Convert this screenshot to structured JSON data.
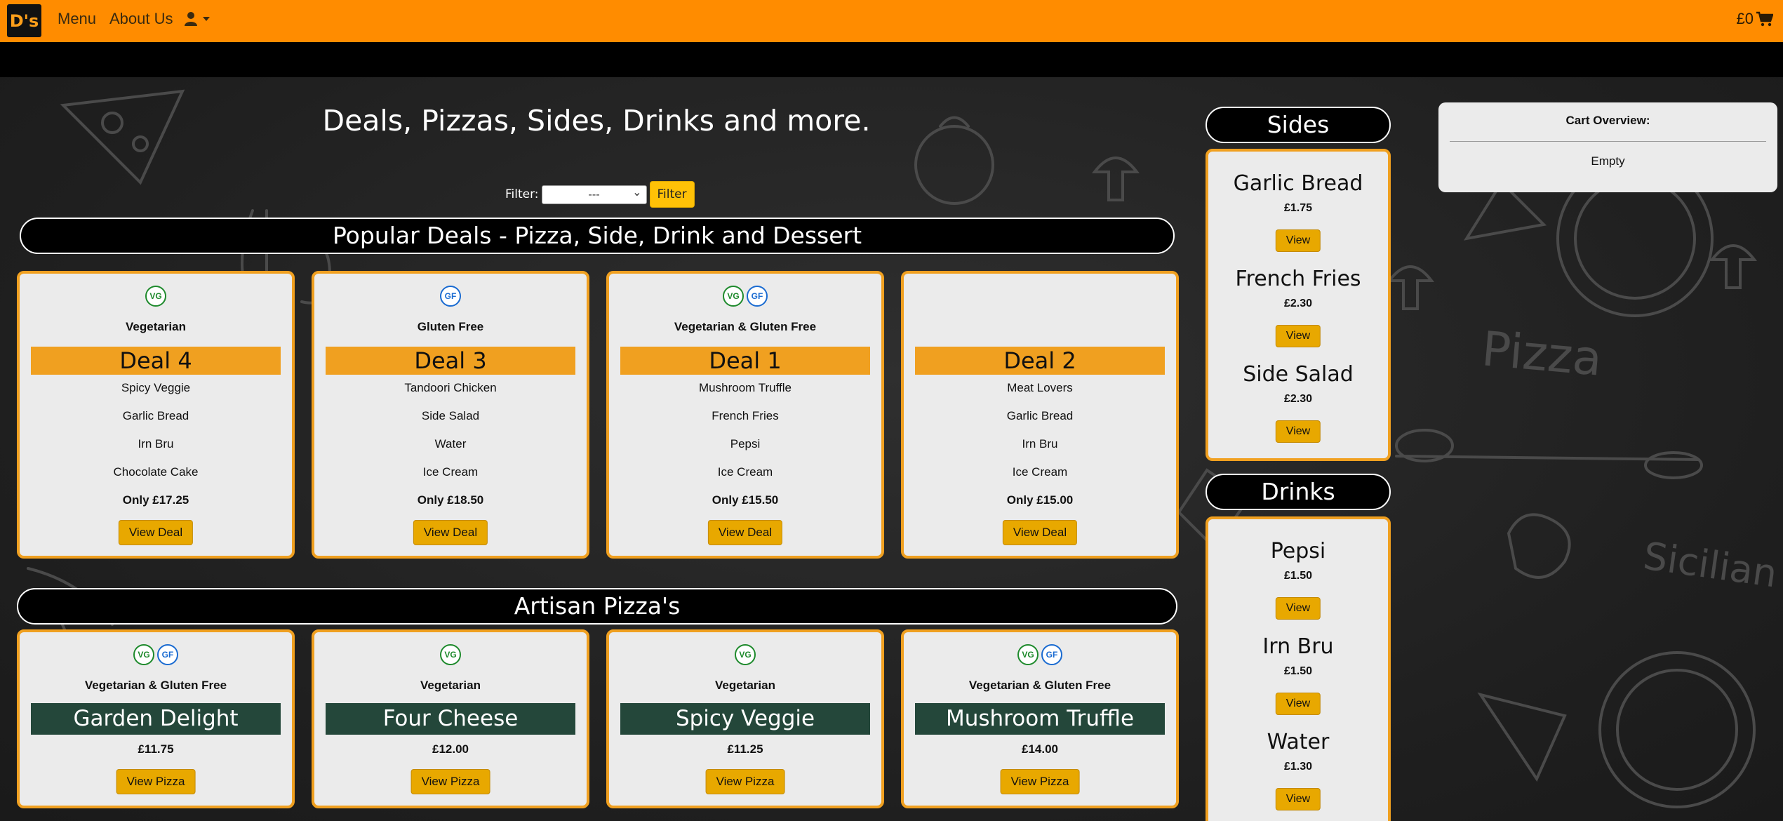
{
  "navbar": {
    "logo": "D's",
    "menu_label": "Menu",
    "about_label": "About Us",
    "cart_total": "£0"
  },
  "page": {
    "heading": "Deals, Pizzas, Sides, Drinks and more.",
    "filter_label": "Filter:",
    "filter_selected": "---",
    "filter_button": "Filter"
  },
  "deals_section": {
    "title": "Popular Deals - Pizza, Side, Drink and Dessert",
    "cards": [
      {
        "badges": [
          "VG"
        ],
        "category": "Vegetarian",
        "name": "Deal 4",
        "items": [
          "Spicy Veggie",
          "Garlic Bread",
          "Irn Bru",
          "Chocolate Cake"
        ],
        "price": "Only £17.25",
        "button": "View Deal"
      },
      {
        "badges": [
          "GF"
        ],
        "category": "Gluten Free",
        "name": "Deal 3",
        "items": [
          "Tandoori Chicken",
          "Side Salad",
          "Water",
          "Ice Cream"
        ],
        "price": "Only £18.50",
        "button": "View Deal"
      },
      {
        "badges": [
          "VG",
          "GF"
        ],
        "category": "Vegetarian & Gluten Free",
        "name": "Deal 1",
        "items": [
          "Mushroom Truffle",
          "French Fries",
          "Pepsi",
          "Ice Cream"
        ],
        "price": "Only £15.50",
        "button": "View Deal"
      },
      {
        "badges": [],
        "category": "",
        "name": "Deal 2",
        "items": [
          "Meat Lovers",
          "Garlic Bread",
          "Irn Bru",
          "Ice Cream"
        ],
        "price": "Only £15.00",
        "button": "View Deal"
      }
    ]
  },
  "pizza_section": {
    "title": "Artisan Pizza's",
    "cards": [
      {
        "badges": [
          "VG",
          "GF"
        ],
        "category": "Vegetarian & Gluten Free",
        "name": "Garden Delight",
        "price": "£11.75",
        "button": "View Pizza"
      },
      {
        "badges": [
          "VG"
        ],
        "category": "Vegetarian",
        "name": "Four Cheese",
        "price": "£12.00",
        "button": "View Pizza"
      },
      {
        "badges": [
          "VG"
        ],
        "category": "Vegetarian",
        "name": "Spicy Veggie",
        "price": "£11.25",
        "button": "View Pizza"
      },
      {
        "badges": [
          "VG",
          "GF"
        ],
        "category": "Vegetarian & Gluten Free",
        "name": "Mushroom Truffle",
        "price": "£14.00",
        "button": "View Pizza"
      }
    ]
  },
  "sides": {
    "title": "Sides",
    "items": [
      {
        "name": "Garlic Bread",
        "price": "£1.75",
        "button": "View"
      },
      {
        "name": "French Fries",
        "price": "£2.30",
        "button": "View"
      },
      {
        "name": "Side Salad",
        "price": "£2.30",
        "button": "View"
      }
    ]
  },
  "drinks": {
    "title": "Drinks",
    "items": [
      {
        "name": "Pepsi",
        "price": "£1.50",
        "button": "View"
      },
      {
        "name": "Irn Bru",
        "price": "£1.50",
        "button": "View"
      },
      {
        "name": "Water",
        "price": "£1.30",
        "button": "View"
      }
    ]
  },
  "cart_overview": {
    "title": "Cart Overview:",
    "status": "Empty"
  },
  "colors": {
    "navbar": "#ff8c00",
    "accent": "#f0a020",
    "pizza_bar": "#24473a",
    "button": "#e8a800"
  }
}
